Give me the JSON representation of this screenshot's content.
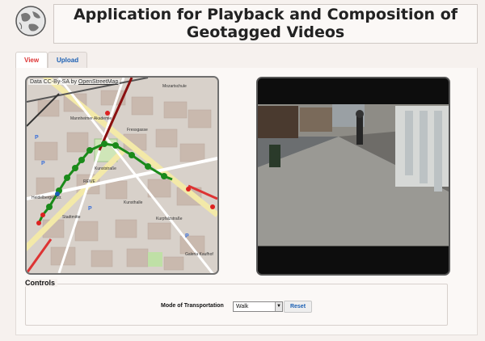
{
  "header": {
    "title_line1": "Application for Playback and Composition of",
    "title_line2": "Geotagged Videos"
  },
  "tabs": [
    {
      "label": "View",
      "active": true
    },
    {
      "label": "Upload",
      "active": false
    }
  ],
  "map": {
    "attribution_prefix": "Data CC-By-SA by ",
    "attribution_link": "OpenStreetMap",
    "route_color": "#1a8a1a",
    "street_labels": [
      "Mozartschule",
      "Fressgasse",
      "Mannheimer Akademie",
      "Heidelberger Str.",
      "Kunststraße",
      "REWE",
      "Kunsthalle",
      "Galeria Kaufhof",
      "Stadtmitte",
      "Kurpfalzstraße"
    ]
  },
  "controls": {
    "legend": "Controls",
    "mode_label": "Mode of Transportation",
    "mode_value": "Walk",
    "reset_label": "Reset"
  }
}
